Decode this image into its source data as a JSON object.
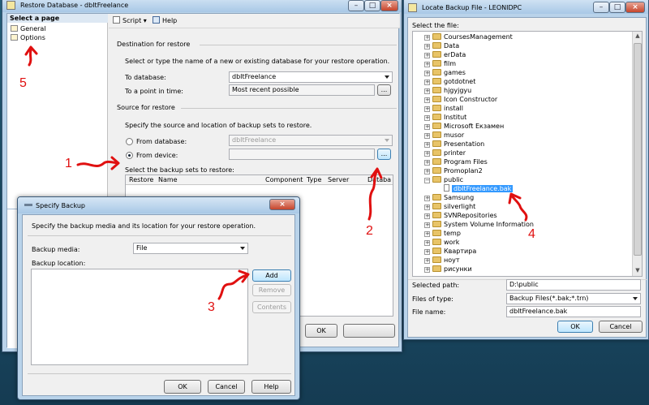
{
  "restore_window": {
    "title": "Restore Database - dbItFreelance",
    "select_page_label": "Select a page",
    "pages": [
      "General",
      "Options"
    ],
    "toolbar": {
      "script": "Script",
      "help": "Help"
    },
    "destination_header": "Destination for restore",
    "destination_hint": "Select or type the name of a new or existing database for your restore operation.",
    "to_database_label": "To database:",
    "to_database_value": "dbItFreelance",
    "to_point_label": "To a point in time:",
    "to_point_value": "Most recent possible",
    "source_header": "Source for restore",
    "source_hint": "Specify the source and location of backup sets to restore.",
    "from_database_label": "From database:",
    "from_database_value": "dbItFreelance",
    "from_device_label": "From device:",
    "backup_sets_label": "Select the backup sets to restore:",
    "grid_columns": [
      "Restore",
      "Name",
      "Component",
      "Type",
      "Server",
      "Databa"
    ],
    "ok": "OK",
    "ellipsis": "..."
  },
  "specify_backup": {
    "title": "Specify Backup",
    "hint": "Specify the backup media and its location for your restore operation.",
    "media_label": "Backup media:",
    "media_value": "File",
    "location_label": "Backup location:",
    "add": "Add",
    "remove": "Remove",
    "contents": "Contents",
    "ok": "OK",
    "cancel": "Cancel",
    "help": "Help"
  },
  "locate_backup": {
    "title": "Locate Backup File - LEONIDPC",
    "select_file_label": "Select the file:",
    "folders": [
      "CoursesManagement",
      "Data",
      "erData",
      "film",
      "games",
      "gotdotnet",
      "hjgyjgyu",
      "Icon Constructor",
      "install",
      "Institut",
      "Microsoft Екзамен",
      "musor",
      "Presentation",
      "printer",
      "Program Files",
      "Promoplan2",
      "public"
    ],
    "selected_file": "dbItFreelance.bak",
    "folders_after": [
      "Samsung",
      "silverlight",
      "SVNRepositories",
      "System Volume Information",
      "temp",
      "work",
      "Квартира",
      "ноут",
      "рисунки"
    ],
    "selected_path_label": "Selected path:",
    "selected_path_value": "D:\\public",
    "files_of_type_label": "Files of type:",
    "files_of_type_value": "Backup Files(*.bak;*.trn)",
    "file_name_label": "File name:",
    "file_name_value": "dbItFreelance.bak",
    "ok": "OK",
    "cancel": "Cancel"
  },
  "annotations": [
    "1",
    "2",
    "3",
    "4",
    "5"
  ],
  "colors": {
    "annotation": "#e01010",
    "selection": "#3399ff"
  },
  "icons": [
    "window-app-icon",
    "script-icon",
    "help-icon",
    "page-icon",
    "folder-icon",
    "file-icon",
    "minimize-icon",
    "maximize-icon",
    "close-icon"
  ]
}
